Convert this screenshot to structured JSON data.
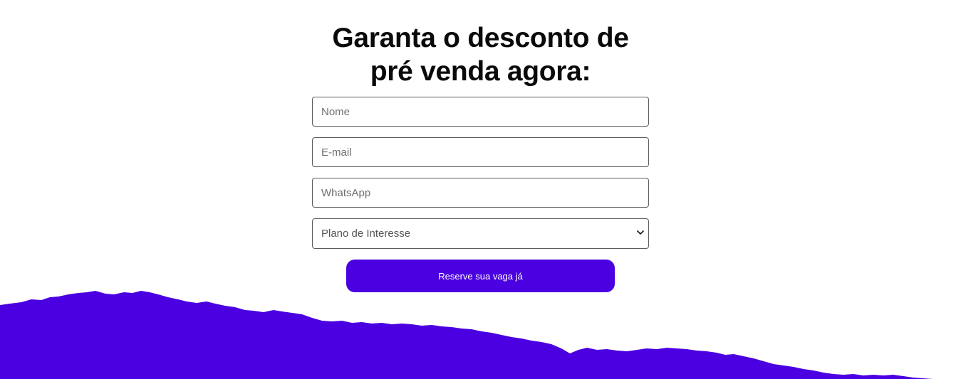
{
  "heading": {
    "line1": "Garanta o desconto de",
    "line2": "pré venda agora:"
  },
  "form": {
    "name_placeholder": "Nome",
    "email_placeholder": "E-mail",
    "whatsapp_placeholder": "WhatsApp",
    "plan_selected": "Plano de Interesse",
    "submit_label": "Reserve sua vaga já"
  },
  "colors": {
    "accent": "#4a00e0",
    "background": "#ffffff",
    "heading_text": "#0a0a0a"
  },
  "icons": {
    "select_arrow": "chevron-down-icon"
  }
}
